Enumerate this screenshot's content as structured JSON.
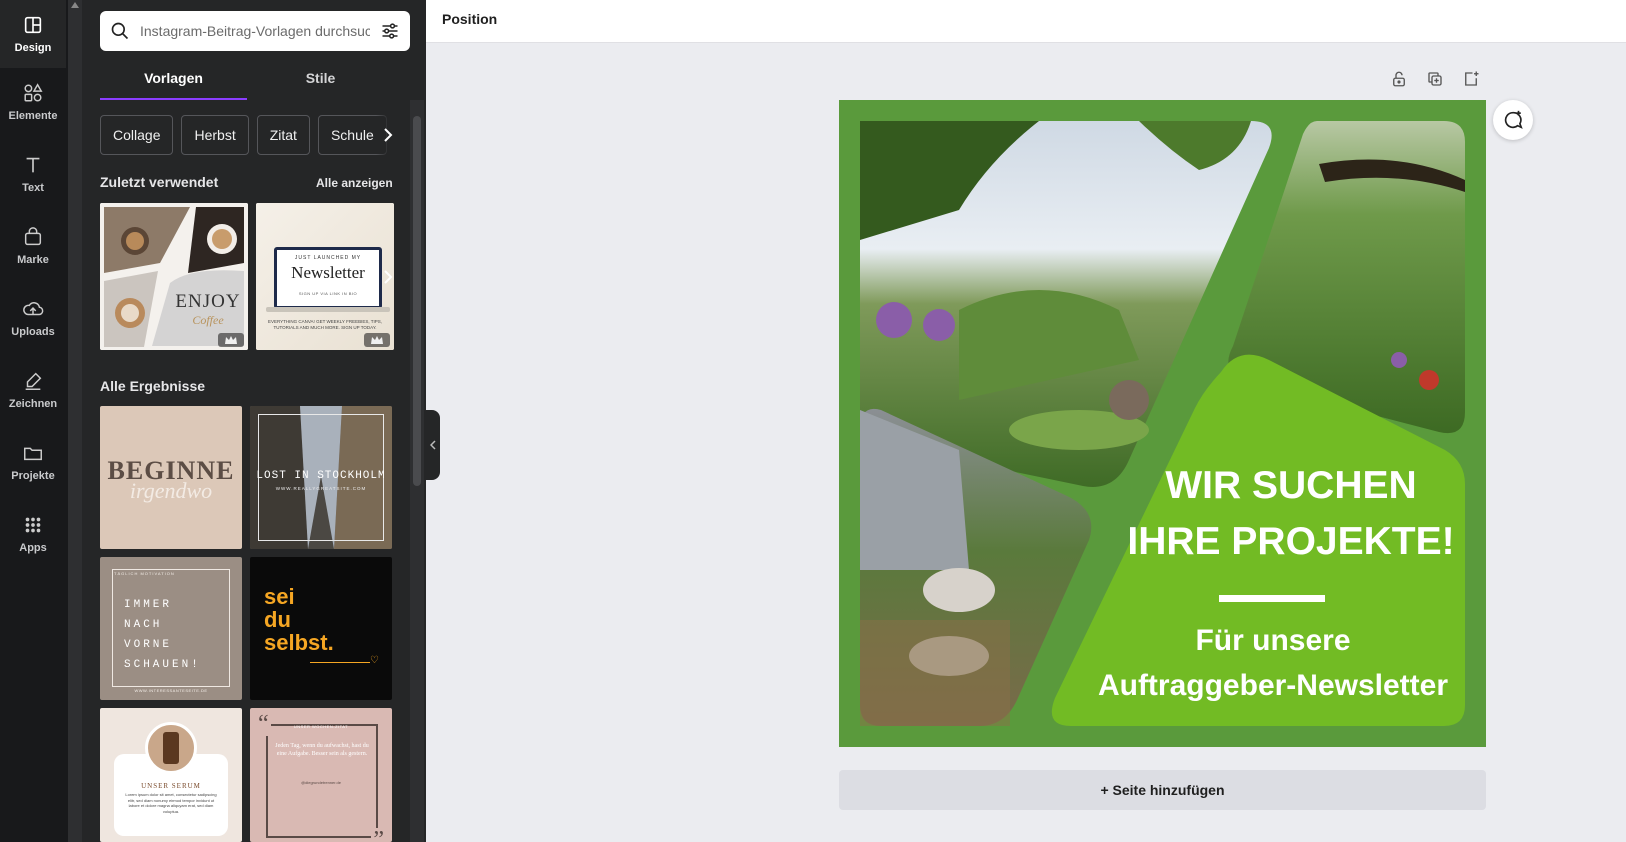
{
  "rail": {
    "items": [
      {
        "label": "Design",
        "icon": "layout-icon"
      },
      {
        "label": "Elemente",
        "icon": "shapes-icon"
      },
      {
        "label": "Text",
        "icon": "text-icon"
      },
      {
        "label": "Marke",
        "icon": "brand-icon"
      },
      {
        "label": "Uploads",
        "icon": "upload-cloud-icon"
      },
      {
        "label": "Zeichnen",
        "icon": "draw-icon"
      },
      {
        "label": "Projekte",
        "icon": "folder-icon"
      },
      {
        "label": "Apps",
        "icon": "apps-grid-icon"
      }
    ]
  },
  "search": {
    "placeholder": "Instagram-Beitrag-Vorlagen durchsuchen"
  },
  "tabs": [
    {
      "label": "Vorlagen"
    },
    {
      "label": "Stile"
    }
  ],
  "chips": [
    "Collage",
    "Herbst",
    "Zitat",
    "Schule"
  ],
  "recent": {
    "title": "Zuletzt verwendet",
    "see_all": "Alle anzeigen",
    "t1": {
      "line1": "ENJOY",
      "line2": "Coffee"
    },
    "t2": {
      "top": "JUST LAUNCHED MY",
      "title": "Newsletter",
      "sub": "SIGN UP VIA LINK IN BIO",
      "body": "EVERYTHING CANVA! GET WEEKLY FREEBIES, TIPS, TUTORIALS AND MUCH MORE. SIGN UP TODAY."
    }
  },
  "results": {
    "title": "Alle Ergebnisse",
    "r1": {
      "line1": "BEGINNE",
      "line2": "irgendwo"
    },
    "r2": {
      "line1": "LOST IN STOCKHOLM",
      "line2": "WWW.REALLYGREATSITE.COM"
    },
    "r3": {
      "top": "TÄGLICH MOTIVATION",
      "lines": [
        "IMMER",
        "NACH",
        "VORNE",
        "SCHAUEN!"
      ],
      "footer": "WWW.INTERESSANTESEITE.DE"
    },
    "r4": {
      "lines": [
        "sei",
        "du",
        "selbst."
      ]
    },
    "r5": {
      "title": "UNSER SERUM",
      "body": "Lorem ipsum dolor sit amet, consectetur sadipscing elitr, sed diam nonumy eirmod tempor invidunt ut labore et dolore magna aliquyam erat, sed diam voluptua."
    },
    "r6": {
      "top": "UNSER WOCHEN-ZITAT",
      "body": "Jeden Tag, wenn du aufwachst, hast du eine Aufgabe. Besser sein als gestern.",
      "footer": "@diegrundetrenner.de"
    }
  },
  "topbar": {
    "position_label": "Position"
  },
  "design": {
    "headline1": "WIR SUCHEN",
    "headline2": "IHRE PROJEKTE!",
    "sub1": "Für unsere",
    "sub2": "Auftraggeber-Newsletter",
    "bg_color": "#5a9a3c",
    "accent_color": "#72bb24"
  },
  "add_page_label": "+ Seite hinzufügen"
}
